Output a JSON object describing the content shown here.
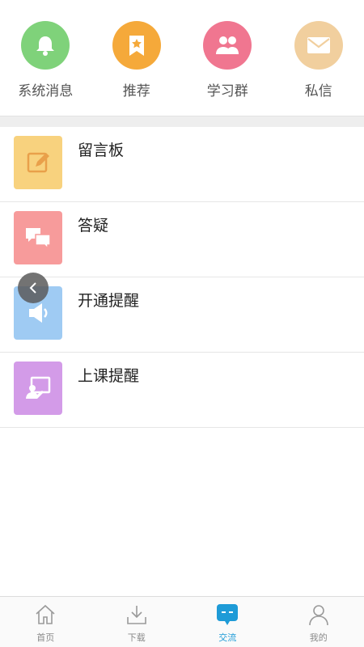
{
  "shortcuts": [
    {
      "label": "系统消息",
      "icon": "bell-icon",
      "color": "#7fd27a"
    },
    {
      "label": "推荐",
      "icon": "bookmark-star-icon",
      "color": "#f5a93a"
    },
    {
      "label": "学习群",
      "icon": "group-icon",
      "color": "#f07690"
    },
    {
      "label": "私信",
      "icon": "envelope-icon",
      "color": "#f1cf9e"
    }
  ],
  "list": [
    {
      "label": "留言板",
      "icon": "note-edit-icon",
      "color": "#f8d27e"
    },
    {
      "label": "答疑",
      "icon": "chat-bubbles-icon",
      "color": "#f79b9b"
    },
    {
      "label": "开通提醒",
      "icon": "speaker-icon",
      "color": "#9fcbf3"
    },
    {
      "label": "上课提醒",
      "icon": "teacher-board-icon",
      "color": "#d39be8"
    }
  ],
  "tabs": [
    {
      "label": "首页",
      "icon": "home-icon",
      "active": false
    },
    {
      "label": "下载",
      "icon": "download-icon",
      "active": false
    },
    {
      "label": "交流",
      "icon": "chat-icon",
      "active": true
    },
    {
      "label": "我的",
      "icon": "user-icon",
      "active": false
    }
  ],
  "colors": {
    "accent": "#1e9bd7"
  }
}
